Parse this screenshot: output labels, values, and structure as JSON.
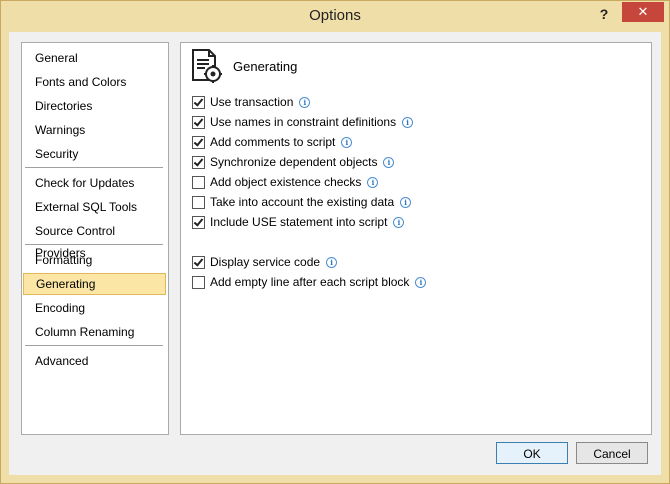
{
  "window": {
    "title": "Options",
    "help_glyph": "?",
    "close_glyph": "✕"
  },
  "nav": {
    "items": [
      {
        "label": "General",
        "selected": false
      },
      {
        "label": "Fonts and Colors",
        "selected": false
      },
      {
        "label": "Directories",
        "selected": false
      },
      {
        "label": "Warnings",
        "selected": false
      },
      {
        "label": "Security",
        "selected": false
      },
      {
        "label": "Check for Updates",
        "selected": false
      },
      {
        "label": "External SQL Tools",
        "selected": false
      },
      {
        "label": "Source Control Providers",
        "selected": false
      },
      {
        "label": "Formatting",
        "selected": false
      },
      {
        "label": "Generating",
        "selected": true
      },
      {
        "label": "Encoding",
        "selected": false
      },
      {
        "label": "Column Renaming",
        "selected": false
      },
      {
        "label": "Advanced",
        "selected": false
      }
    ]
  },
  "panel": {
    "title": "Generating",
    "header_icon": "script-settings-icon",
    "options": [
      {
        "label": "Use transaction",
        "checked": true
      },
      {
        "label": "Use names in constraint definitions",
        "checked": true
      },
      {
        "label": "Add comments to script",
        "checked": true
      },
      {
        "label": "Synchronize dependent objects",
        "checked": true
      },
      {
        "label": "Add object existence checks",
        "checked": false
      },
      {
        "label": "Take into account the existing data",
        "checked": false
      },
      {
        "label": "Include USE statement into script",
        "checked": true
      },
      {
        "label": "Display service code",
        "checked": true
      },
      {
        "label": "Add empty line after each script block",
        "checked": false
      }
    ],
    "info_glyph": "i"
  },
  "buttons": {
    "ok": "OK",
    "cancel": "Cancel"
  },
  "colors": {
    "window_frame": "#f0dea8",
    "close_button": "#c7463c",
    "selected_nav": "#fbe6a6",
    "info_icon": "#2d74c4"
  }
}
